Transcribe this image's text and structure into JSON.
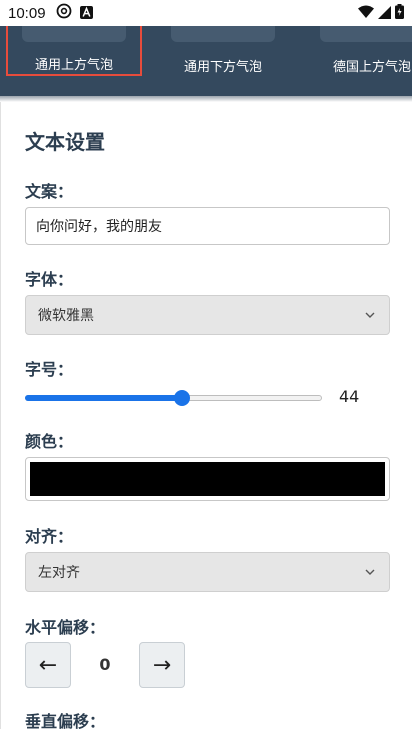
{
  "status_bar": {
    "time": "10:09",
    "icons": [
      "at-sign-icon",
      "notification-a-icon",
      "wifi-icon",
      "signal-icon",
      "battery-icon"
    ]
  },
  "templates": [
    {
      "label": "通用上方气泡",
      "selected": true
    },
    {
      "label": "通用下方气泡",
      "selected": false
    },
    {
      "label": "德国上方气泡",
      "selected": false
    }
  ],
  "panel": {
    "title": "文本设置",
    "text": {
      "label": "文案：",
      "value": "向你问好，我的朋友"
    },
    "font": {
      "label": "字体：",
      "selected": "微软雅黑"
    },
    "size": {
      "label": "字号：",
      "value": 44,
      "fraction": 0.53
    },
    "color": {
      "label": "颜色：",
      "value": "#000000"
    },
    "align": {
      "label": "对齐：",
      "selected": "左对齐"
    },
    "h_offset": {
      "label": "水平偏移：",
      "value": 0,
      "left_symbol": "←",
      "right_symbol": "→"
    },
    "v_offset": {
      "label": "垂直偏移："
    }
  },
  "colors": {
    "strip_bg": "#34495e",
    "selected_border": "#e74c3c",
    "accent": "#1a73e8",
    "heading": "#2c3e50"
  }
}
